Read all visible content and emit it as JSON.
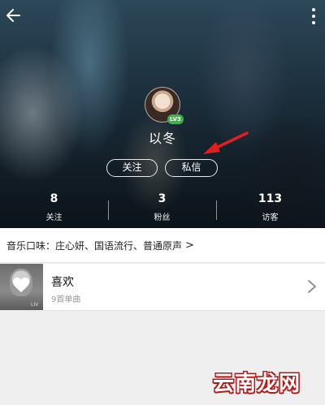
{
  "header": {
    "nickname": "以冬",
    "level_badge": "LV3",
    "follow_button": "关注",
    "message_button": "私信"
  },
  "stats": [
    {
      "value": "8",
      "label": "关注"
    },
    {
      "value": "3",
      "label": "粉丝"
    },
    {
      "value": "113",
      "label": "访客"
    }
  ],
  "taste": {
    "text": "音乐口味：庄心妍、国语流行、普通原声",
    "chevron": ">"
  },
  "playlist": {
    "title": "喜欢",
    "subtitle": "9首单曲",
    "cover_label": "LIV"
  },
  "watermark": "云南龙网",
  "colors": {
    "level_badge": "#3bb34a",
    "annotation_arrow": "#e02020",
    "watermark_outline": "#b51818"
  },
  "icons": [
    "back-arrow-icon",
    "more-vertical-icon",
    "heart-icon",
    "chevron-right-icon"
  ]
}
